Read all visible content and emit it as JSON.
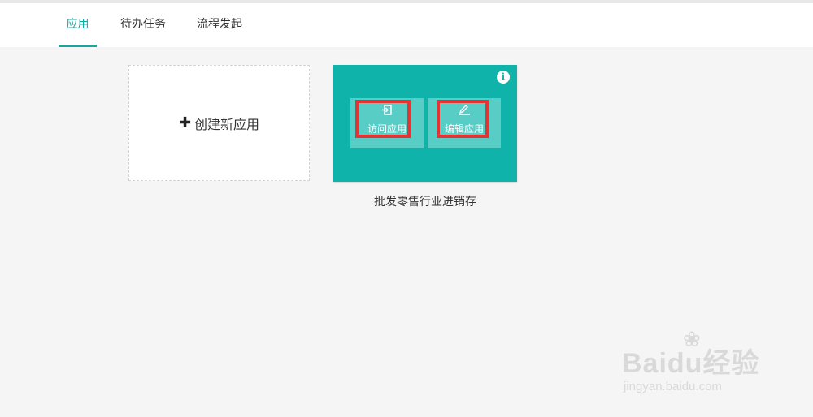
{
  "tabs": [
    {
      "label": "应用",
      "active": true
    },
    {
      "label": "待办任务",
      "active": false
    },
    {
      "label": "流程发起",
      "active": false
    }
  ],
  "create_card": {
    "icon": "plus-icon",
    "label": "创建新应用"
  },
  "app_card": {
    "name": "批发零售行业进销存",
    "accent_color": "#0fb3a9",
    "info_icon": "info-icon",
    "visit": {
      "label": "访问应用",
      "icon": "enter-icon"
    },
    "edit": {
      "label": "编辑应用",
      "icon": "edit-icon"
    }
  },
  "watermark": {
    "brand": "Baidu经验",
    "url": "jingyan.baidu.com"
  }
}
